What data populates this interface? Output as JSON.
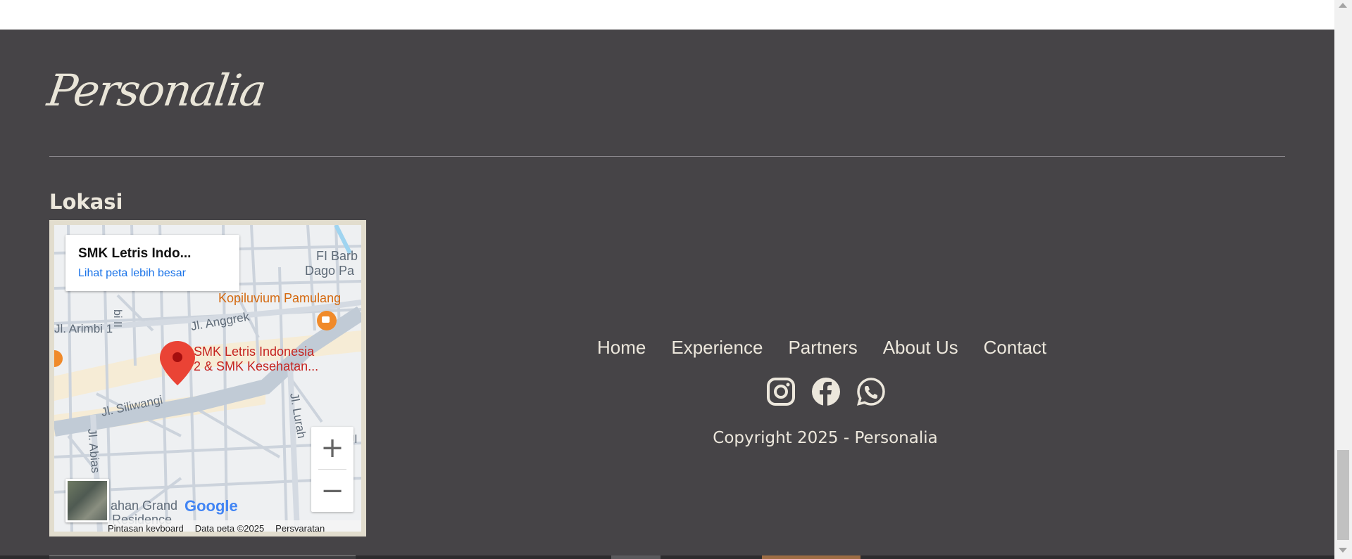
{
  "footer": {
    "brand": "Personalia",
    "location_heading": "Lokasi",
    "map": {
      "place_name": "SMK Letris Indo...",
      "larger_map_link": "Lihat peta lebih besar",
      "labels": {
        "poi_top_right": "FI Barb",
        "poi_top_right_2": "Dago Pa",
        "cafe": "Kopiluvium Pamulang",
        "street_arimbi": "Jl. Arimbi 1",
        "street_anggrek": "Jl. Anggrek",
        "pin_line1": "SMK Letris Indonesia",
        "pin_line2": "2 & SMK Kesehatan...",
        "street_siliwangi": "Jl. Siliwangi",
        "street_lurah": "Jl. Lurah",
        "street_abias": "Jl. Abias",
        "residence_line1": "ahan Grand",
        "residence_line2": "Residence",
        "street_bi": "bi II",
        "street_jl": "Jl"
      },
      "zoom_in": "+",
      "zoom_out": "−",
      "google_logo": "Google",
      "attribution": {
        "shortcuts": "Pintasan keyboard",
        "data": "Data peta ©2025",
        "terms": "Persyaratan"
      }
    },
    "nav": [
      "Home",
      "Experience",
      "Partners",
      "About Us",
      "Contact"
    ],
    "socials": [
      "instagram-icon",
      "facebook-icon",
      "whatsapp-icon"
    ],
    "copyright": "Copyright 2025 - Personalia",
    "colors": {
      "background": "#464447",
      "text": "#ece7dc",
      "accent_pin": "#ea4335",
      "link": "#1a73e8"
    }
  }
}
